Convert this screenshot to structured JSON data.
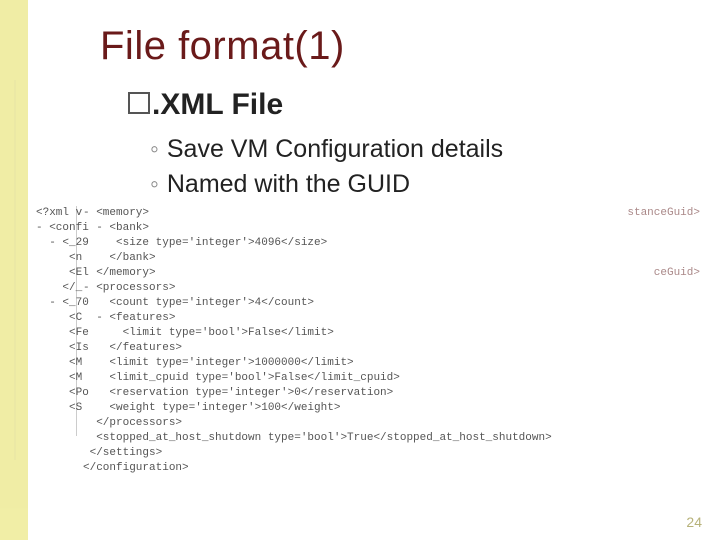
{
  "title": "File format(1)",
  "subtitle_prefix": ".",
  "subtitle": "XML File",
  "points": [
    "Save VM Configuration details",
    "Named with the GUID"
  ],
  "code_col_left": [
    "<?xml v",
    "- <confi",
    "  - <_29",
    "     <n",
    "     <El",
    "    </_",
    "  - <_70",
    "     <C",
    "     <Fe",
    "     <Is",
    "     <M",
    "     <M",
    "     <Po",
    "     <S"
  ],
  "code_col_center": [
    "- <memory>",
    "  - <bank>",
    "     <size type='integer'>4096</size>",
    "    </bank>",
    "  </memory>",
    "- <processors>",
    "    <count type='integer'>4</count>",
    "  - <features>",
    "      <limit type='bool'>False</limit>",
    "    </features>",
    "    <limit type='integer'>1000000</limit>",
    "    <limit_cpuid type='bool'>False</limit_cpuid>",
    "    <reservation type='integer'>0</reservation>",
    "    <weight type='integer'>100</weight>",
    "  </processors>",
    "  <stopped_at_host_shutdown type='bool'>True</stopped_at_host_shutdown>",
    " </settings>",
    "</configuration>"
  ],
  "code_col_right": [
    "stanceGuid>",
    "",
    "",
    "",
    "ceGuid>"
  ],
  "page_number": "24"
}
